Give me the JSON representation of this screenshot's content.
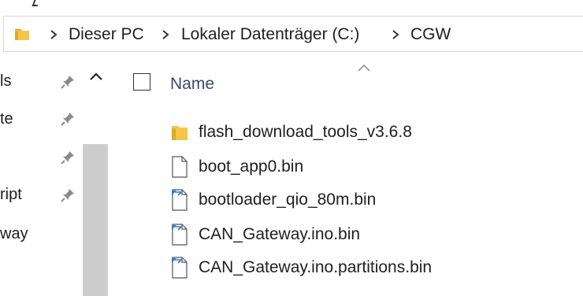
{
  "window": {
    "address_bar": {
      "crumbs": [
        {
          "label": "Dieser PC"
        },
        {
          "label": "Lokaler Datenträger (C:)"
        },
        {
          "label": "CGW"
        }
      ]
    }
  },
  "nav_pane": {
    "items": [
      {
        "label": "ls",
        "pinned": true
      },
      {
        "label": "te",
        "pinned": true
      },
      {
        "label": "",
        "pinned": true
      },
      {
        "label": "ript",
        "pinned": true
      },
      {
        "label": "way",
        "pinned": false
      }
    ]
  },
  "file_list": {
    "column_name": "Name",
    "files": [
      {
        "name": "flash_download_tools_v3.6.8",
        "icon": "folder-icon"
      },
      {
        "name": "boot_app0.bin",
        "icon": "file-icon"
      },
      {
        "name": "bootloader_qio_80m.bin",
        "icon": "bin-file-icon"
      },
      {
        "name": "CAN_Gateway.ino.bin",
        "icon": "bin-file-icon"
      },
      {
        "name": "CAN_Gateway.ino.partitions.bin",
        "icon": "bin-file-icon"
      }
    ]
  },
  "colors": {
    "folder_yellow": "#f4c54a",
    "folder_dark": "#dfa928",
    "scroll_thumb": "#cdcdcd",
    "accent_blue": "#2b7cd3",
    "header_text": "#3b4a6b"
  }
}
